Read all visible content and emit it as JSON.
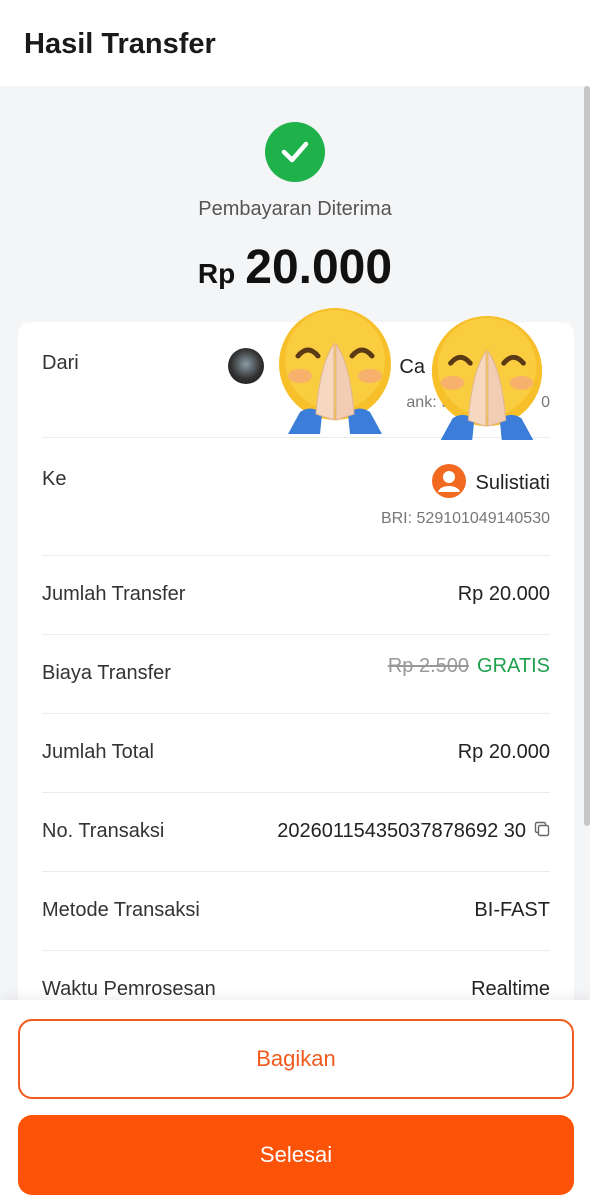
{
  "header": {
    "title": "Hasil Transfer"
  },
  "status": {
    "text": "Pembayaran Diterima"
  },
  "amount": {
    "currency": "Rp",
    "value": "20.000"
  },
  "details": {
    "dari": {
      "label": "Dari",
      "name_visible_a": "I",
      "name_visible_b": "Ca",
      "bank_visible_a": "ank: 9",
      "bank_visible_b": "0"
    },
    "ke": {
      "label": "Ke",
      "name": "Sulistiati",
      "bank": "BRI: 529101049140530"
    },
    "jumlah_transfer": {
      "label": "Jumlah Transfer",
      "value": "Rp 20.000"
    },
    "biaya_transfer": {
      "label": "Biaya Transfer",
      "original": "Rp 2.500",
      "value": "GRATIS"
    },
    "jumlah_total": {
      "label": "Jumlah Total",
      "value": "Rp 20.000"
    },
    "no_transaksi": {
      "label": "No. Transaksi",
      "value": "20260115435037878692 30"
    },
    "metode_transaksi": {
      "label": "Metode Transaksi",
      "value": "BI-FAST"
    },
    "waktu_pemrosesan": {
      "label": "Waktu Pemrosesan",
      "value": "Realtime"
    }
  },
  "buttons": {
    "share": "Bagikan",
    "done": "Selesai"
  },
  "colors": {
    "accent": "#fd5308",
    "success": "#1fb14a",
    "free": "#1fa04e"
  },
  "icons": [
    "check-icon",
    "user-icon",
    "copy-icon",
    "praying-emoji-icon"
  ]
}
